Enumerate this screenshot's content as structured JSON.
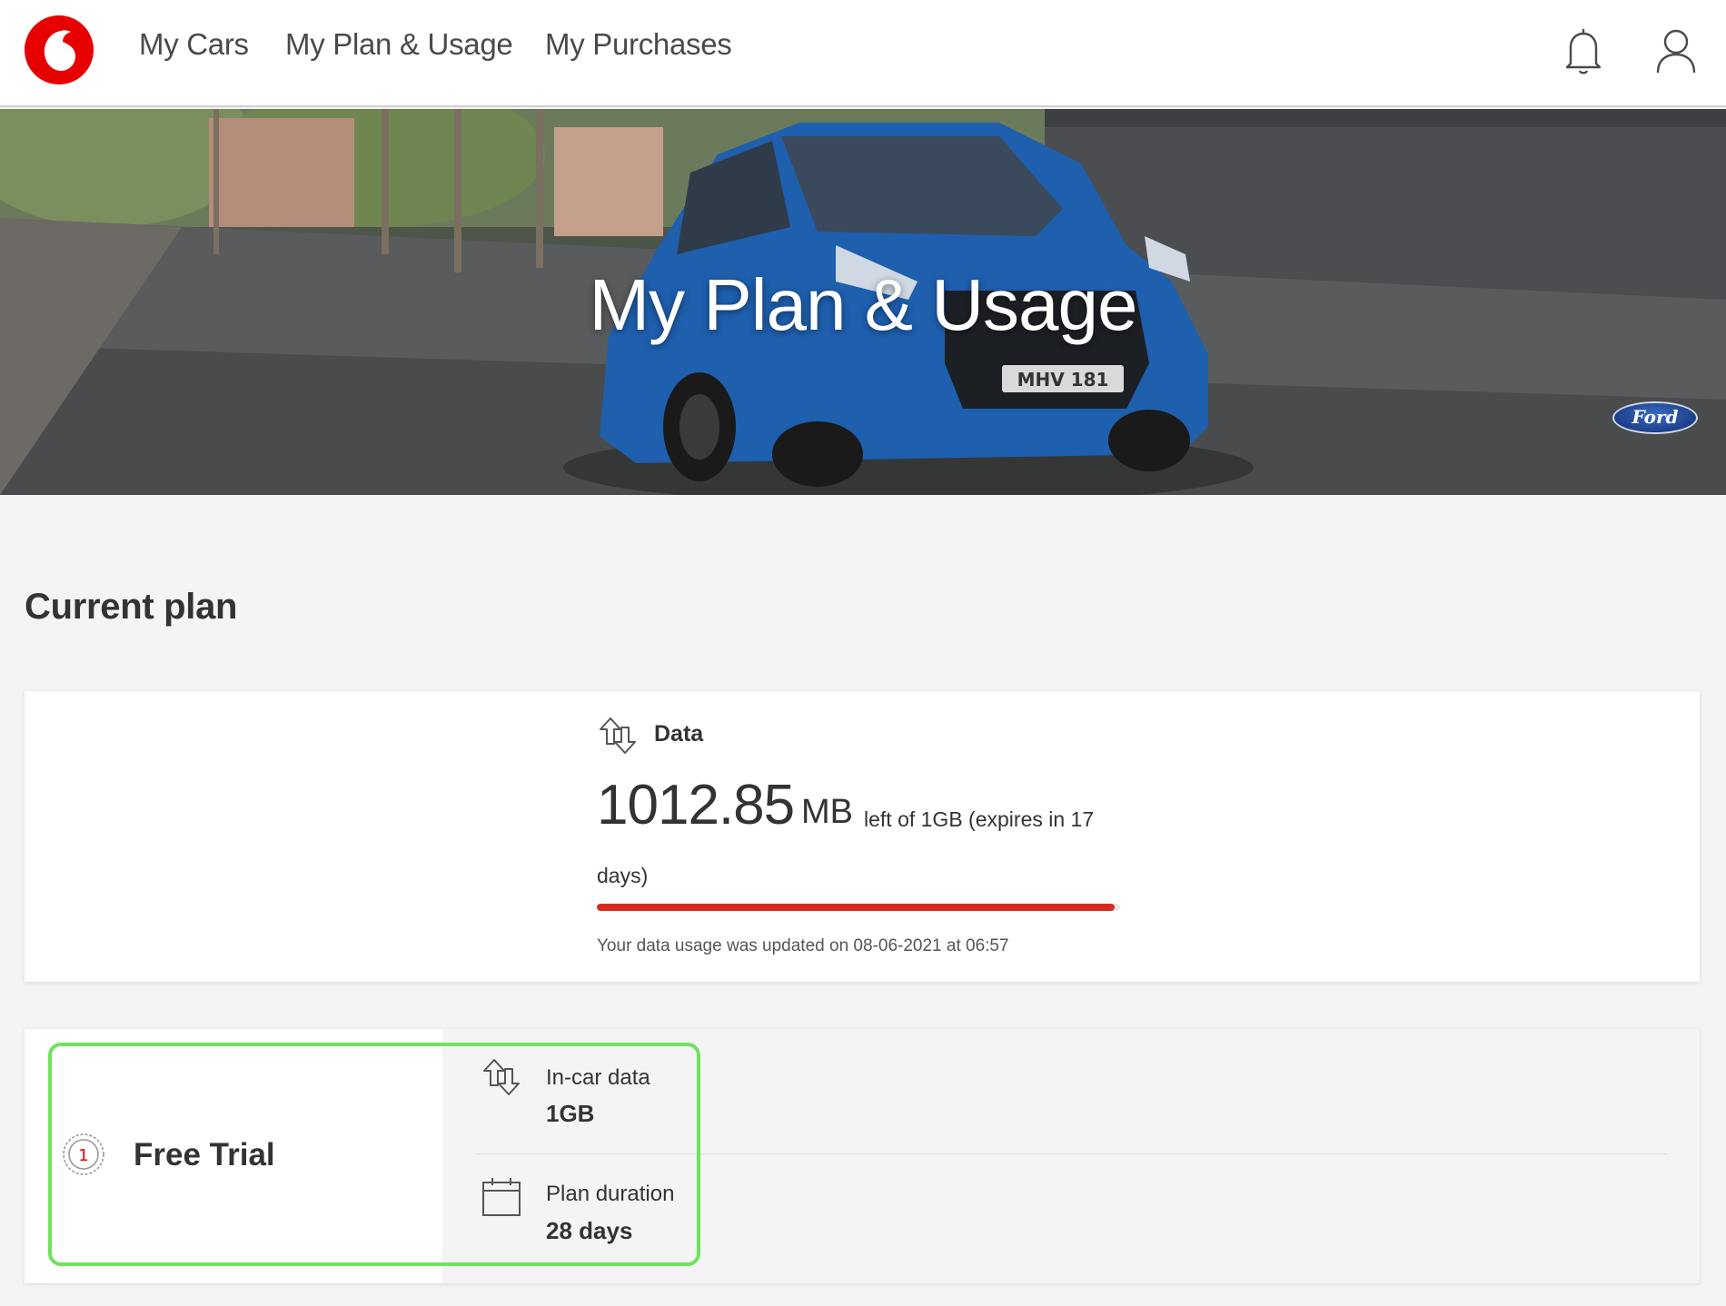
{
  "brand": {
    "logo_icon": "vodafone-logo-icon",
    "accent_color": "#e60000"
  },
  "nav": {
    "items": [
      {
        "label": "My Cars"
      },
      {
        "label": "My Plan & Usage"
      },
      {
        "label": "My Purchases"
      }
    ],
    "icons": [
      "bell-icon",
      "user-icon"
    ]
  },
  "hero": {
    "title": "My Plan & Usage",
    "plate": "MHV 181",
    "car_brand": "Ford"
  },
  "current_plan": {
    "heading": "Current plan",
    "data": {
      "label": "Data",
      "amount": "1012.85",
      "unit": "MB",
      "remaining_text_1": "left of 1GB (expires in 17",
      "remaining_text_2": "days)",
      "usage_remaining_fraction": 0.99,
      "bar_color": "#d52b1e",
      "updated_text": "Your data usage was updated on 08-06-2021 at 06:57"
    }
  },
  "plan": {
    "name": "Free Trial",
    "badge_number": "1",
    "in_car_data_label": "In-car data",
    "in_car_data_value": "1GB",
    "duration_label": "Plan duration",
    "duration_value": "28 days",
    "highlight_color": "#6fe35c"
  }
}
